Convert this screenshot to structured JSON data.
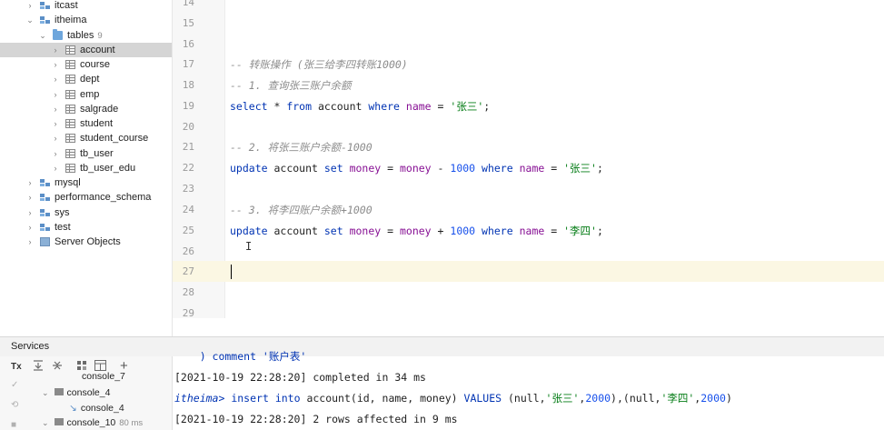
{
  "tree": {
    "items": [
      {
        "label": "itcast",
        "icon": "database-icon",
        "chevron": "›",
        "count": ""
      },
      {
        "label": "itheima",
        "icon": "database-icon",
        "chevron": "⌄",
        "count": ""
      },
      {
        "label": "tables",
        "icon": "folder-icon",
        "chevron": "⌄",
        "count": "9"
      },
      {
        "label": "account",
        "icon": "table-icon",
        "chevron": "›",
        "count": ""
      },
      {
        "label": "course",
        "icon": "table-icon",
        "chevron": "›",
        "count": ""
      },
      {
        "label": "dept",
        "icon": "table-icon",
        "chevron": "›",
        "count": ""
      },
      {
        "label": "emp",
        "icon": "table-icon",
        "chevron": "›",
        "count": ""
      },
      {
        "label": "salgrade",
        "icon": "table-icon",
        "chevron": "›",
        "count": ""
      },
      {
        "label": "student",
        "icon": "table-icon",
        "chevron": "›",
        "count": ""
      },
      {
        "label": "student_course",
        "icon": "table-icon",
        "chevron": "›",
        "count": ""
      },
      {
        "label": "tb_user",
        "icon": "table-icon",
        "chevron": "›",
        "count": ""
      },
      {
        "label": "tb_user_edu",
        "icon": "table-icon",
        "chevron": "›",
        "count": ""
      },
      {
        "label": "mysql",
        "icon": "database-icon",
        "chevron": "›",
        "count": ""
      },
      {
        "label": "performance_schema",
        "icon": "database-icon",
        "chevron": "›",
        "count": ""
      },
      {
        "label": "sys",
        "icon": "database-icon",
        "chevron": "›",
        "count": ""
      },
      {
        "label": "test",
        "icon": "database-icon",
        "chevron": "›",
        "count": ""
      },
      {
        "label": "Server Objects",
        "icon": "server-objects-icon",
        "chevron": "›",
        "count": ""
      }
    ],
    "selected": "account"
  },
  "editor": {
    "line_numbers": [
      "14",
      "15",
      "16",
      "17",
      "18",
      "19",
      "20",
      "21",
      "22",
      "23",
      "24",
      "25",
      "26",
      "27",
      "28",
      "29"
    ],
    "lines": {
      "l17": "-- 转账操作 (张三给李四转账1000)",
      "l18": "-- 1. 查询张三账户余额",
      "l19": {
        "k1": "select",
        "p1": " * ",
        "k2": "from",
        "p2": " account ",
        "k3": "where",
        "p3": " ",
        "c1": "name",
        "p4": " = ",
        "s1": "'张三'",
        "p5": ";"
      },
      "l21": "-- 2. 将张三账户余额-1000",
      "l22": {
        "k1": "update",
        "p1": " account ",
        "k2": "set",
        "p2": " ",
        "c1": "money",
        "p3": " = ",
        "c2": "money",
        "p4": " - ",
        "n1": "1000",
        "p5": " ",
        "k3": "where",
        "p6": " ",
        "c3": "name",
        "p7": " = ",
        "s1": "'张三'",
        "p8": ";"
      },
      "l24": "-- 3. 将李四账户余额+1000",
      "l25": {
        "k1": "update",
        "p1": " account ",
        "k2": "set",
        "p2": " ",
        "c1": "money",
        "p3": " = ",
        "c2": "money",
        "p4": " + ",
        "n1": "1000",
        "p5": " ",
        "k3": "where",
        "p6": " ",
        "c3": "name",
        "p7": " = ",
        "s1": "'李四'",
        "p8": ";"
      }
    }
  },
  "services": {
    "title": "Services",
    "toolbar_icons": [
      "transaction-mode-icon",
      "expand-all-icon",
      "collapse-all-icon",
      "group-icon",
      "layout-icon",
      "add-icon"
    ],
    "tx_label": "Tx",
    "add_label": "+",
    "items": [
      {
        "label": "console_7",
        "sub": ""
      },
      {
        "label": "console_4",
        "sub": ""
      },
      {
        "label": "console_4",
        "sub": ""
      },
      {
        "label": "console_10",
        "sub": "80 ms"
      }
    ]
  },
  "console": {
    "lines": [
      "    ) comment '账户表'",
      "[2021-10-19 22:28:20] completed in 34 ms",
      {
        "prompt": "itheima>",
        "kw1": "insert",
        "p1": " ",
        "kw2": "into",
        "p2": " account(id, name, money) ",
        "kw3": "VALUES",
        "p3": " (null,",
        "s1": "'张三'",
        "p4": ",",
        "n1": "2000",
        "p5": "),(null,",
        "s2": "'李四'",
        "p6": ",",
        "n2": "2000",
        "p7": ")"
      },
      "[2021-10-19 22:28:20] 2 rows affected in 9 ms"
    ]
  },
  "colors": {
    "keyword": "#0033b3",
    "column": "#871094",
    "string": "#067d17",
    "number": "#1750eb",
    "comment": "#8c8c8c",
    "selection": "#d5d5d5",
    "current_line": "#fbf7e3"
  }
}
